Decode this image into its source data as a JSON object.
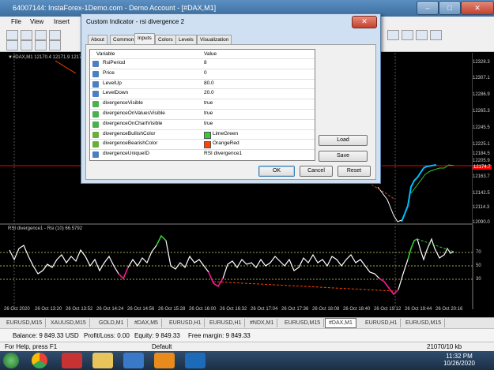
{
  "window": {
    "title": "64007144: InstaForex-1Demo.com - Demo Account - [#DAX,M1]",
    "minimize": "–",
    "maximize": "□",
    "close": "✕"
  },
  "menu": [
    "File",
    "View",
    "Insert"
  ],
  "chart": {
    "ohlc_header": "▼#DAX,M1  12170.4 12171.9 12170.4 12170.4",
    "indicator_title": "RSI divergence1 - Rsi (10) 66.5792",
    "price_labels": [
      "12328.3",
      "12307.1",
      "12286.9",
      "12265.3",
      "12245.5",
      "12225.1",
      "12205.9",
      "12184.5",
      "12174.7",
      "12163.7",
      "12142.5",
      "12114.3",
      "12090.0"
    ],
    "rsi_levels": [
      "70",
      "50",
      "30"
    ],
    "time_labels": [
      "26 Oct 2020",
      "26 Oct 13:20",
      "26 Oct 13:52",
      "26 Oct 14:24",
      "26 Oct 14:56",
      "26 Oct 15:28",
      "26 Oct 16:00",
      "26 Oct 16:32",
      "26 Oct 17:04",
      "26 Oct 17:36",
      "26 Oct 18:08",
      "26 Oct 18:40",
      "26 Oct 19:12",
      "26 Oct 19:44",
      "26 Oct 20:16"
    ],
    "colors": {
      "bullish": "#32cd32",
      "bearish": "#ff4500",
      "line": "#ffffff",
      "current_price": "#ff0000",
      "level_line": "#9aa84a"
    }
  },
  "tabs": [
    "EURUSD,M15",
    "XAUUSD,M15",
    "GOLD,M1",
    "#DAX,M5",
    "EURUSD,H1",
    "EURUSD,H1",
    "#NDX,M1",
    "EURUSD,M15",
    "#DAX,M1",
    "EURUSD,H1",
    "EURUSD,M15"
  ],
  "active_tab": "#DAX,M1",
  "account": {
    "balance": "Balance: 9 849.33 USD",
    "profit": "Profit/Loss: 0.00",
    "equity": "Equity: 9 849.33",
    "free_margin": "Free margin: 9 849.33"
  },
  "status": {
    "help": "For Help, press F1",
    "profile": "Default",
    "traffic": "21070/10 kb"
  },
  "clock": {
    "time": "11:32 PM",
    "date": "10/26/2020"
  },
  "dialog": {
    "title": "Custom Indicator - rsi divergence 2",
    "tabs": [
      "About",
      "Common",
      "Inputs",
      "Colors",
      "Levels",
      "Visualization"
    ],
    "active_tab": "Inputs",
    "col_variable": "Variable",
    "col_value": "Value",
    "params": [
      {
        "name": "RsiPeriod",
        "value": "8",
        "icon": "number"
      },
      {
        "name": "Price",
        "value": "0",
        "icon": "number"
      },
      {
        "name": "LevelUp",
        "value": "80.0",
        "icon": "number"
      },
      {
        "name": "LevelDown",
        "value": "20.0",
        "icon": "number"
      },
      {
        "name": "divergenceVisible",
        "value": "true",
        "icon": "bool"
      },
      {
        "name": "divergenceOnValuesVisible",
        "value": "true",
        "icon": "bool"
      },
      {
        "name": "divergenceOnChartVisible",
        "value": "true",
        "icon": "bool"
      },
      {
        "name": "divergenceBullishColor",
        "value": "LimeGreen",
        "icon": "color",
        "swatch": "#32cd32"
      },
      {
        "name": "divergenceBearishColor",
        "value": "OrangeRed",
        "icon": "color",
        "swatch": "#ff4500"
      },
      {
        "name": "divergenceUniqueID",
        "value": "RSI divergence1",
        "icon": "string"
      }
    ],
    "buttons": {
      "load": "Load",
      "save": "Save",
      "ok": "OK",
      "cancel": "Cancel",
      "reset": "Reset"
    }
  }
}
